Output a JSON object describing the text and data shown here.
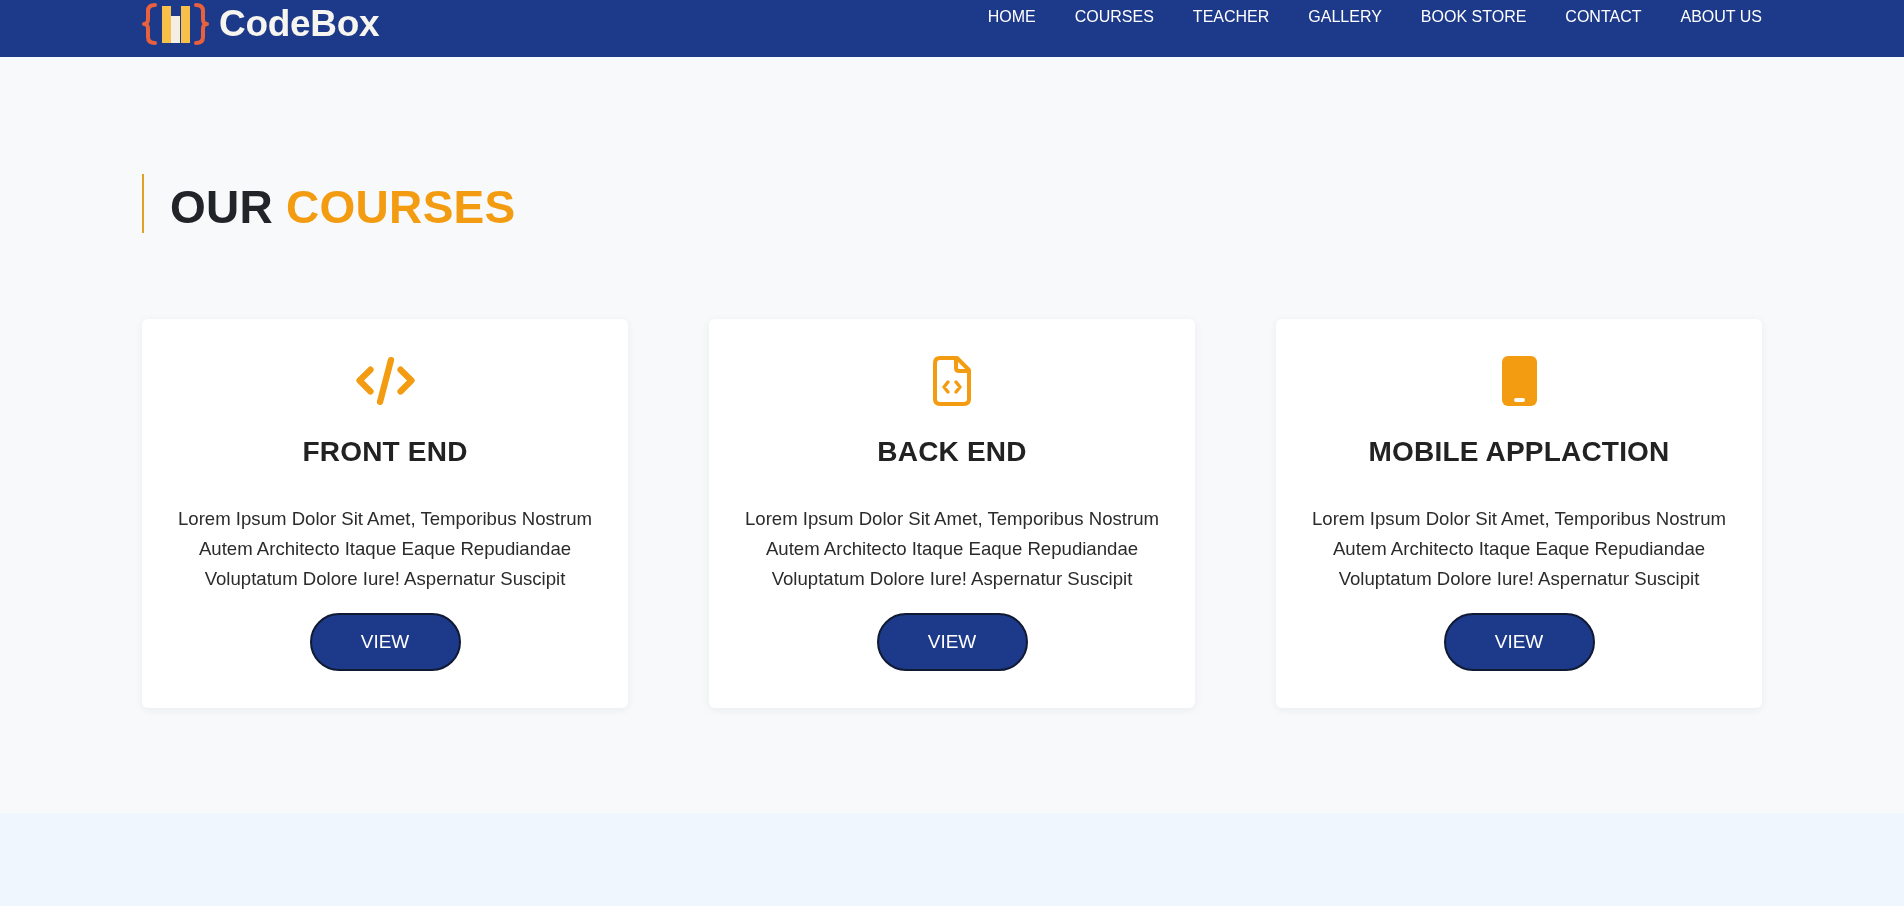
{
  "header": {
    "logo": {
      "text": "CodeBox"
    },
    "nav": [
      {
        "label": "HOME"
      },
      {
        "label": "COURSES"
      },
      {
        "label": "TEACHER"
      },
      {
        "label": "GALLERY"
      },
      {
        "label": "BOOK STORE"
      },
      {
        "label": "CONTACT"
      },
      {
        "label": "ABOUT US"
      }
    ]
  },
  "section": {
    "title": {
      "text": "OUR",
      "accent": "COURSES"
    },
    "cards": [
      {
        "kind": "frontend",
        "title": "FRONT END",
        "description": "Lorem Ipsum Dolor Sit Amet, Temporibus Nostrum Autem Architecto Itaque Eaque Repudiandae Voluptatum Dolore Iure! Aspernatur Suscipit",
        "button": "VIEW"
      },
      {
        "kind": "backend",
        "title": "BACK END",
        "description": "Lorem Ipsum Dolor Sit Amet, Temporibus Nostrum Autem Architecto Itaque Eaque Repudiandae Voluptatum Dolore Iure! Aspernatur Suscipit",
        "button": "VIEW"
      },
      {
        "kind": "mobile",
        "title": "MOBILE APPLACTION",
        "description": "Lorem Ipsum Dolor Sit Amet, Temporibus Nostrum Autem Architecto Itaque Eaque Repudiandae Voluptatum Dolore Iure! Aspernatur Suscipit",
        "button": "VIEW"
      }
    ]
  }
}
